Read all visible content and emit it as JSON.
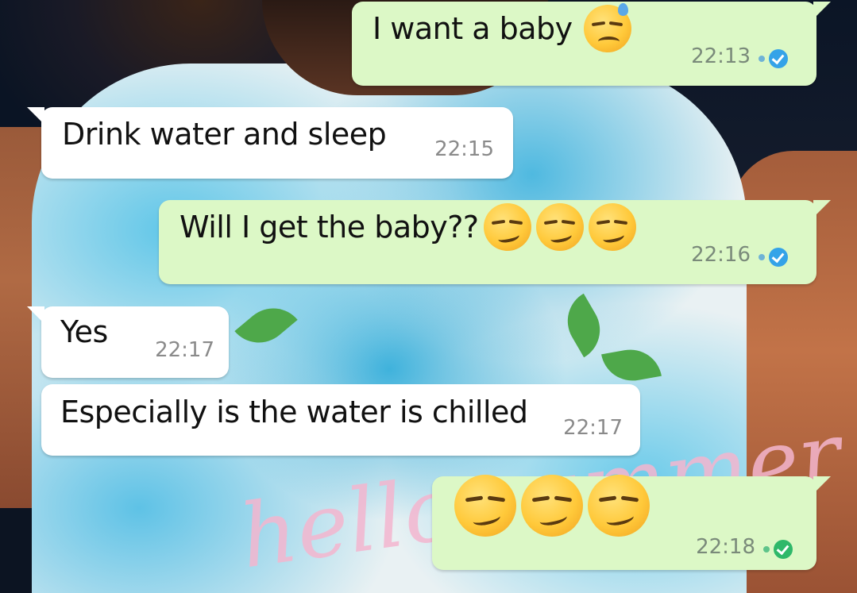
{
  "messages": [
    {
      "direction": "out",
      "text": "I want a baby",
      "emoji": [
        "sad-sweat-emoji"
      ],
      "time": "22:13",
      "status": "read"
    },
    {
      "direction": "in",
      "text": "Drink water and sleep",
      "time": "22:15"
    },
    {
      "direction": "out",
      "text": "Will I get the baby??",
      "emoji": [
        "smirk-emoji",
        "smirk-emoji",
        "smirk-emoji"
      ],
      "time": "22:16",
      "status": "read"
    },
    {
      "direction": "in",
      "text": "Yes",
      "time": "22:17"
    },
    {
      "direction": "in",
      "text": "Especially is the water is chilled",
      "time": "22:17"
    },
    {
      "direction": "out",
      "text": "",
      "emoji": [
        "smirk-emoji",
        "smirk-emoji",
        "smirk-emoji"
      ],
      "time": "22:18",
      "status": "read"
    }
  ],
  "colors": {
    "outgoing_bubble": "#dcf8c6",
    "incoming_bubble": "#ffffff",
    "read_tick": "#34a3e8",
    "timestamp": "#7a8a7a"
  },
  "background": {
    "shirt_text": "hello summer"
  }
}
